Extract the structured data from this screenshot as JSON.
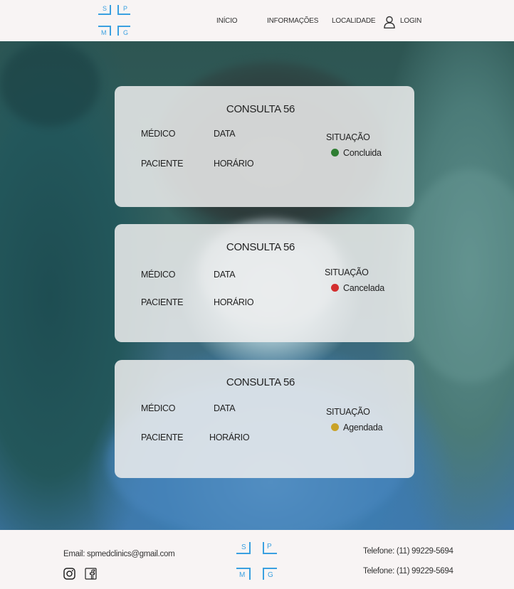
{
  "header": {
    "logo": {
      "letters": [
        "S",
        "P",
        "M",
        "G"
      ]
    },
    "nav": {
      "inicio": "INÍCIO",
      "informacoes": "INFORMAÇÕES",
      "localidade": "LOCALIDADE",
      "login": "LOGIN"
    },
    "login_icon": "user-icon"
  },
  "cards": [
    {
      "title": "CONSULTA 56",
      "medico": "MÉDICO",
      "data": "DATA",
      "paciente": "PACIENTE",
      "horario": "HORÁRIO",
      "situacao_label": "SITUAÇÃO",
      "status": "Concluida",
      "status_color": "#2e7d32"
    },
    {
      "title": "CONSULTA 56",
      "medico": "MÉDICO",
      "data": "DATA",
      "paciente": "PACIENTE",
      "horario": "HORÁRIO",
      "situacao_label": "SITUAÇÃO",
      "status": "Cancelada",
      "status_color": "#d32f2f"
    },
    {
      "title": "CONSULTA 56",
      "medico": "MÉDICO",
      "data": "DATA",
      "paciente": "PACIENTE",
      "horario": "HORÁRIO",
      "situacao_label": "SITUAÇÃO",
      "status": "Agendada",
      "status_color": "#c9a227"
    }
  ],
  "footer": {
    "email": "Email: spmedclinics@gmail.com",
    "phone_1": "Telefone: (11) 99229-5694",
    "phone_2": "Telefone: (11) 99229-5694",
    "logo": {
      "letters": [
        "S",
        "P",
        "M",
        "G"
      ]
    },
    "social": [
      "instagram-icon",
      "facebook-icon"
    ]
  },
  "colors": {
    "accent": "#3aa0e0",
    "logo_footer": "#3aa0e0"
  }
}
